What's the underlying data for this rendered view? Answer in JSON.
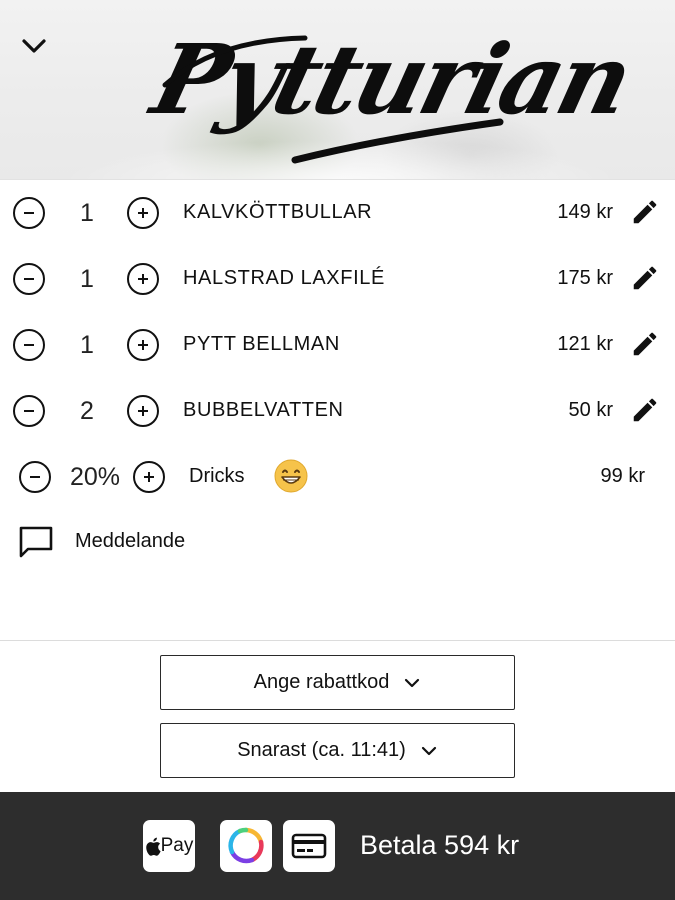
{
  "header": {
    "logo_text": "Pytturian",
    "back_icon": "chevron-down-icon"
  },
  "items": [
    {
      "qty": "1",
      "name": "KALVKÖTTBULLAR",
      "price": "149 kr"
    },
    {
      "qty": "1",
      "name": "HALSTRAD LAXFILÉ",
      "price": "175 kr"
    },
    {
      "qty": "1",
      "name": "PYTT BELLMAN",
      "price": "121 kr"
    },
    {
      "qty": "2",
      "name": "BUBBELVATTEN",
      "price": "50 kr"
    }
  ],
  "tip": {
    "percent": "20%",
    "label": "Dricks",
    "emoji": "grinning-face-emoji",
    "price": "99 kr"
  },
  "message": {
    "label": "Meddelande",
    "icon": "message-icon"
  },
  "discount": {
    "label": "Ange rabattkod"
  },
  "pickup": {
    "label": "Snarast (ca. 11:41)"
  },
  "payment": {
    "apple_pay_label": "Pay",
    "swish_icon": "swish-icon",
    "card_icon": "credit-card-icon",
    "pay_label": "Betala 594 kr"
  },
  "colors": {
    "paybar": "#2d2d2d",
    "text": "#111111",
    "emoji": "#f6c34a"
  }
}
